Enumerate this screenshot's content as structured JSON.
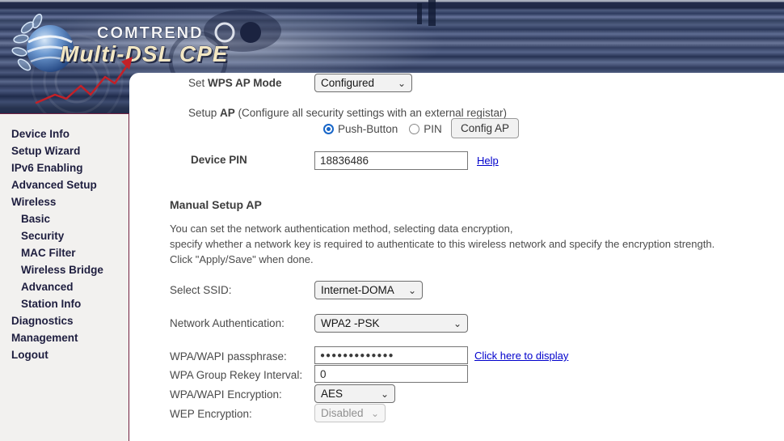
{
  "header": {
    "brand": "COMTREND",
    "product": "Multi-DSL CPE"
  },
  "icons": {
    "chevron_down": "⌄"
  },
  "colors": {
    "sidebar_border": "#722040",
    "sidebar_text": "#1e1e3f",
    "link_blue": "#0000cc",
    "radio_blue": "#1866c8",
    "brand_cream": "#f3e7c3",
    "arrow_red": "#c32027"
  },
  "sidebar": {
    "items": [
      {
        "label": "Device Info"
      },
      {
        "label": "Setup Wizard"
      },
      {
        "label": "IPv6 Enabling"
      },
      {
        "label": "Advanced Setup"
      },
      {
        "label": "Wireless"
      },
      {
        "label": "Basic"
      },
      {
        "label": "Security"
      },
      {
        "label": "MAC Filter"
      },
      {
        "label": "Wireless Bridge"
      },
      {
        "label": "Advanced"
      },
      {
        "label": "Station Info"
      },
      {
        "label": "Diagnostics"
      },
      {
        "label": "Management"
      },
      {
        "label": "Logout"
      }
    ]
  },
  "wps": {
    "set_mode_prefix": "Set ",
    "set_mode_bold": "WPS AP Mode",
    "mode_value": "Configured",
    "setup_prefix": "Setup ",
    "setup_bold": "AP",
    "setup_suffix": " (Configure all security settings with an external registar)",
    "radio_push_label": "Push-Button",
    "radio_pin_label": "PIN",
    "config_ap_button": "Config AP",
    "device_pin_label": "Device PIN",
    "device_pin_value": "18836486",
    "help_link": "Help"
  },
  "manual": {
    "heading": "Manual Setup AP",
    "desc_line1": "You can set the network authentication method, selecting data encryption,",
    "desc_line2": "specify whether a network key is required to authenticate to this wireless network and specify the encryption strength.",
    "desc_line3": "Click \"Apply/Save\" when done.",
    "select_ssid_label": "Select SSID:",
    "ssid_value": "Internet-DOMA",
    "network_auth_label": "Network Authentication:",
    "network_auth_value": "WPA2 -PSK",
    "passphrase_label": "WPA/WAPI passphrase:",
    "passphrase_value": "●●●●●●●●●●●●●",
    "show_link": "Click here to display",
    "rekey_label": "WPA Group Rekey Interval:",
    "rekey_value": "0",
    "wpa_encryption_label": "WPA/WAPI Encryption:",
    "wpa_encryption_value": "AES",
    "wep_encryption_label": "WEP Encryption:",
    "wep_encryption_value": "Disabled"
  }
}
